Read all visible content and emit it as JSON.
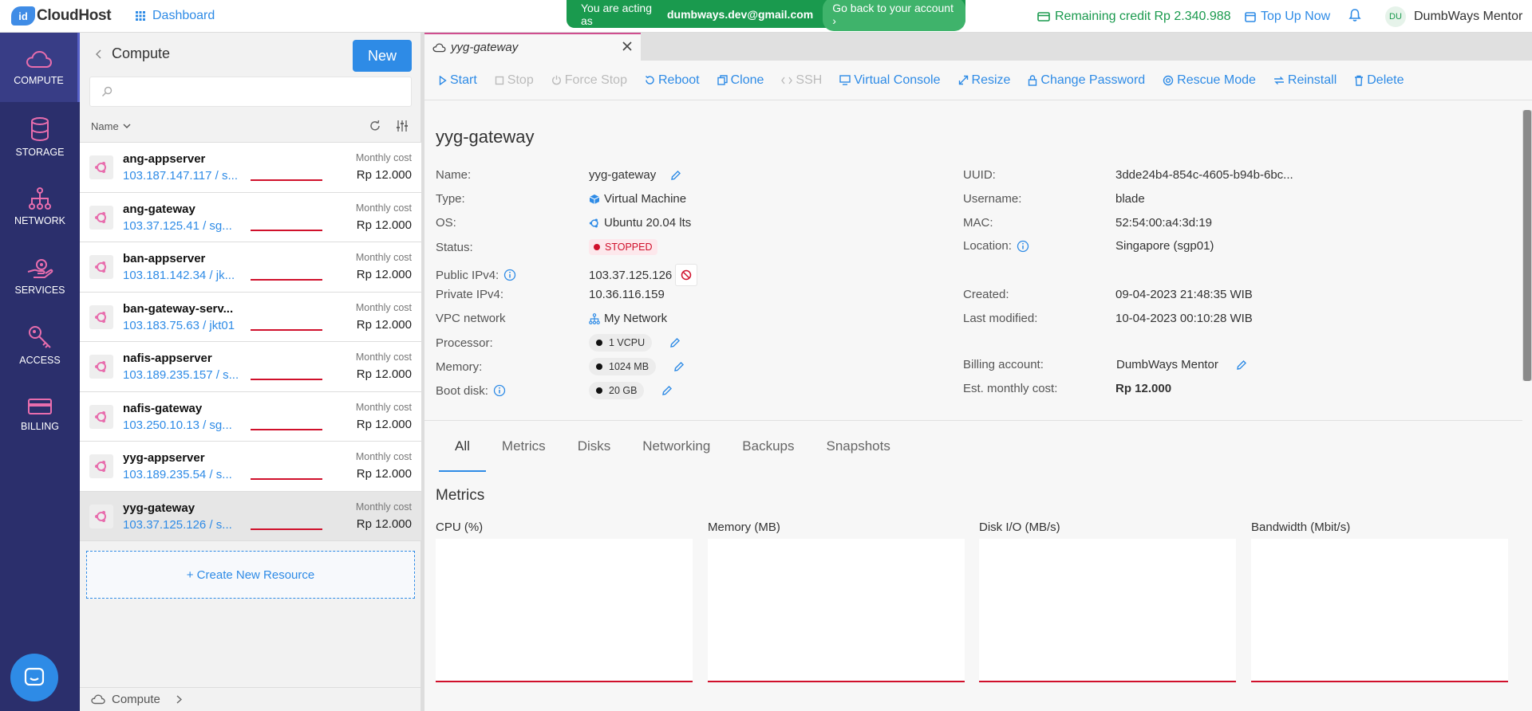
{
  "topbar": {
    "logo_badge": "id",
    "logo_text": "CloudHost",
    "dashboard": "Dashboard",
    "acting_prefix": "You are acting as",
    "acting_email": "dumbways.dev@gmail.com",
    "back_label": "Go back to your account ›",
    "remaining_credit": "Remaining credit Rp 2.340.988",
    "top_up": "Top Up Now",
    "avatar_initials": "DU",
    "user_name": "DumbWays Mentor"
  },
  "sidenav": {
    "items": [
      {
        "label": "COMPUTE",
        "icon": "cloud-icon"
      },
      {
        "label": "STORAGE",
        "icon": "database-icon"
      },
      {
        "label": "NETWORK",
        "icon": "network-icon"
      },
      {
        "label": "SERVICES",
        "icon": "services-icon"
      },
      {
        "label": "ACCESS",
        "icon": "key-icon"
      },
      {
        "label": "BILLING",
        "icon": "card-icon"
      }
    ]
  },
  "list": {
    "title": "Compute",
    "new_label": "New",
    "sort_label": "Name",
    "cost_label": "Monthly cost",
    "items": [
      {
        "name": "ang-appserver",
        "ip": "103.187.147.117 / s...",
        "cost": "Rp 12.000"
      },
      {
        "name": "ang-gateway",
        "ip": "103.37.125.41 / sg...",
        "cost": "Rp 12.000"
      },
      {
        "name": "ban-appserver",
        "ip": "103.181.142.34 / jk...",
        "cost": "Rp 12.000"
      },
      {
        "name": "ban-gateway-serv...",
        "ip": "103.183.75.63 / jkt01",
        "cost": "Rp 12.000"
      },
      {
        "name": "nafis-appserver",
        "ip": "103.189.235.157 / s...",
        "cost": "Rp 12.000"
      },
      {
        "name": "nafis-gateway",
        "ip": "103.250.10.13 / sg...",
        "cost": "Rp 12.000"
      },
      {
        "name": "yyg-appserver",
        "ip": "103.189.235.54 / s...",
        "cost": "Rp 12.000"
      },
      {
        "name": "yyg-gateway",
        "ip": "103.37.125.126 / s...",
        "cost": "Rp 12.000"
      }
    ],
    "create_label": "+ Create New Resource",
    "footer_label": "Compute"
  },
  "detail": {
    "tab_title": "yyg-gateway",
    "toolbar": {
      "start": "Start",
      "stop": "Stop",
      "force_stop": "Force Stop",
      "reboot": "Reboot",
      "clone": "Clone",
      "ssh": "SSH",
      "console": "Virtual Console",
      "resize": "Resize",
      "change_password": "Change Password",
      "rescue": "Rescue Mode",
      "reinstall": "Reinstall",
      "delete": "Delete"
    },
    "title": "yyg-gateway",
    "left_labels": {
      "name": "Name:",
      "type": "Type:",
      "os": "OS:",
      "status": "Status:",
      "public_ip": "Public IPv4:",
      "private_ip": "Private IPv4:",
      "vpc": "VPC network",
      "processor": "Processor:",
      "memory": "Memory:",
      "boot_disk": "Boot disk:"
    },
    "left_values": {
      "name": "yyg-gateway",
      "type": "Virtual Machine",
      "os": "Ubuntu 20.04 lts",
      "status": "STOPPED",
      "public_ip": "103.37.125.126",
      "private_ip": "10.36.116.159",
      "vpc": "My Network",
      "processor": "1 VCPU",
      "memory": "1024 MB",
      "boot_disk": "20 GB"
    },
    "right_labels": {
      "uuid": "UUID:",
      "username": "Username:",
      "mac": "MAC:",
      "location": "Location:",
      "created": "Created:",
      "modified": "Last modified:",
      "billing": "Billing account:",
      "cost": "Est. monthly cost:"
    },
    "right_values": {
      "uuid": "3dde24b4-854c-4605-b94b-6bc...",
      "username": "blade",
      "mac": "52:54:00:a4:3d:19",
      "location": "Singapore (sgp01)",
      "created": "09-04-2023 21:48:35 WIB",
      "modified": "10-04-2023 00:10:28 WIB",
      "billing": "DumbWays Mentor",
      "cost": "Rp 12.000"
    },
    "subtabs": [
      "All",
      "Metrics",
      "Disks",
      "Networking",
      "Backups",
      "Snapshots"
    ],
    "metrics_title": "Metrics",
    "charts": [
      "CPU (%)",
      "Memory (MB)",
      "Disk I/O (MB/s)",
      "Bandwidth (Mbit/s)"
    ]
  },
  "colors": {
    "accent": "#2e8be6",
    "nav": "#2b2f6c",
    "success": "#1a9a4e",
    "danger": "#d0102b",
    "tab_accent": "#d04e8f"
  }
}
